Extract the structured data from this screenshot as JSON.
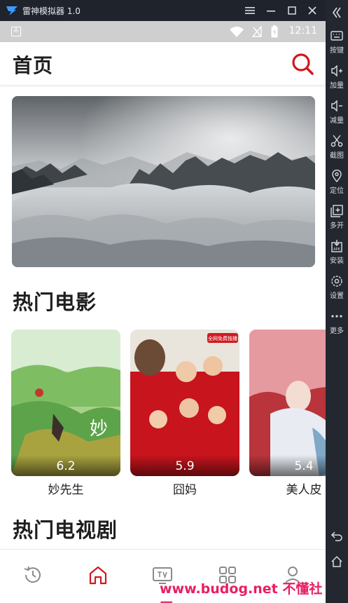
{
  "window": {
    "title": "雷神模拟器 1.0",
    "controls": [
      "menu-icon",
      "minimize-icon",
      "maximize-icon",
      "close-icon"
    ]
  },
  "statusbar": {
    "notification_badge": "A",
    "time": "12:11"
  },
  "appbar": {
    "title": "首页",
    "search_icon": "search-icon",
    "accent_color": "#d0191f"
  },
  "sections": {
    "hot_movies": "热门电影",
    "hot_tv": "热门电视剧"
  },
  "movies": [
    {
      "name": "妙先生",
      "score": "6.2"
    },
    {
      "name": "囧妈",
      "score": "5.9"
    },
    {
      "name": "美人皮",
      "score": "5.4"
    }
  ],
  "posters": {
    "jiongma_tag": "全网免费独播"
  },
  "bottom_nav": [
    {
      "icon": "history-icon",
      "active": false
    },
    {
      "icon": "home-icon",
      "active": true
    },
    {
      "icon": "tv-icon",
      "active": false
    },
    {
      "icon": "grid-icon",
      "active": false
    },
    {
      "icon": "profile-icon",
      "active": false
    }
  ],
  "sidebar": {
    "items": [
      {
        "label": "按键",
        "icon": "keyboard-icon"
      },
      {
        "label": "加量",
        "icon": "volume-up-icon"
      },
      {
        "label": "减量",
        "icon": "volume-down-icon"
      },
      {
        "label": "截图",
        "icon": "scissors-icon"
      },
      {
        "label": "定位",
        "icon": "location-icon"
      },
      {
        "label": "多开",
        "icon": "multi-instance-icon"
      },
      {
        "label": "安装",
        "icon": "apk-install-icon"
      },
      {
        "label": "设置",
        "icon": "settings-icon"
      },
      {
        "label": "更多",
        "icon": "more-icon"
      }
    ],
    "bottom_icons": [
      "back-icon",
      "home-icon"
    ]
  },
  "watermark": "www.budog.net 不懂社区"
}
